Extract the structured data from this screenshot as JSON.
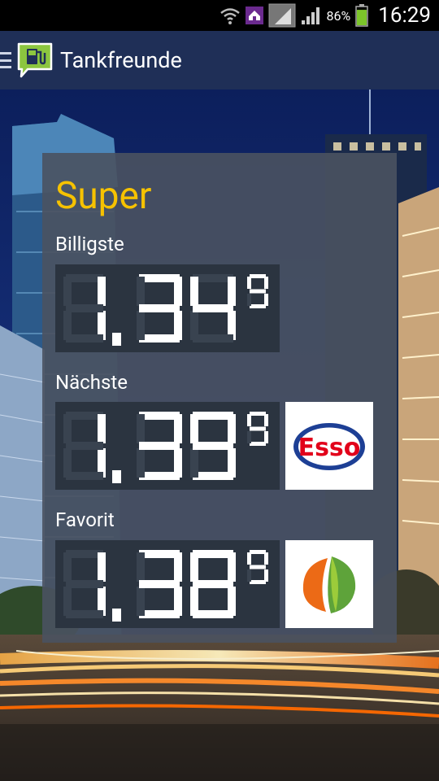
{
  "status_bar": {
    "battery_percent": "86%",
    "clock": "16:29",
    "icons": [
      "wifi-icon",
      "notification-icon",
      "sim-icon",
      "signal-icon",
      "battery-icon"
    ],
    "battery_level": 0.86
  },
  "action_bar": {
    "title": "Tankfreunde",
    "icons": [
      "menu-icon",
      "fuel-pump-icon"
    ]
  },
  "fuel_type": "Super",
  "prices": [
    {
      "label": "Billigste",
      "price": "1,34",
      "tenth": "9",
      "brand": null
    },
    {
      "label": "Nächste",
      "price": "1,39",
      "tenth": "9",
      "brand": "Esso"
    },
    {
      "label": "Favorit",
      "price": "1,38",
      "tenth": "9",
      "brand": "Avia-style green/orange leaf"
    }
  ],
  "colors": {
    "accent_title": "#f6c200",
    "actionbar_bg": "#1f2f57",
    "card_bg": "#4a5260",
    "lcd_on": "#ffffff",
    "lcd_off": "#394350",
    "esso_red": "#e2001a",
    "esso_blue": "#1d3f95",
    "leaf_green": "#5ea33a",
    "leaf_orange": "#ec6a16"
  }
}
